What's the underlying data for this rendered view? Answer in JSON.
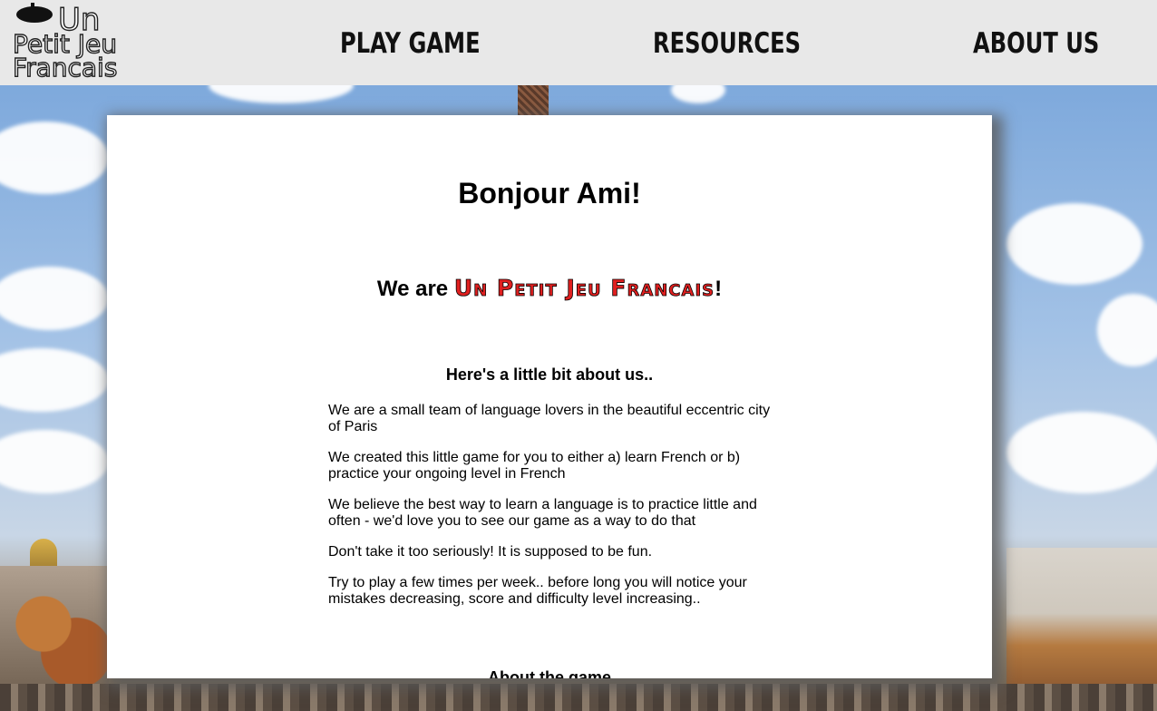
{
  "logo": {
    "line1": "Un",
    "line2": "Petit Jeu",
    "line3": "Francais"
  },
  "nav": {
    "play": "PLAY GAME",
    "resources": "RESOURCES",
    "about": "ABOUT US"
  },
  "content": {
    "greeting": "Bonjour Ami!",
    "we_are_prefix": "We are ",
    "brand": "Un Petit Jeu Francais",
    "we_are_suffix": "!",
    "about_heading": "Here's a little bit about us..",
    "paragraphs": [
      "We are a small team of language lovers in the beautiful eccentric city of Paris",
      "We created this little game for you to either a) learn French or b) practice your ongoing level in French",
      "We believe the best way to learn a language is to practice little and often - we'd love you to see our game as a way to do that",
      "Don't take it too seriously! It is supposed to be fun.",
      "Try to play a few times per week.. before long you will notice your mistakes decreasing, score and difficulty level increasing.."
    ],
    "game_heading": "About the game"
  },
  "colors": {
    "header_bg": "#e8e8e8",
    "brand_red": "#e02020"
  },
  "icons": {
    "logo_hat": "beret-icon"
  }
}
